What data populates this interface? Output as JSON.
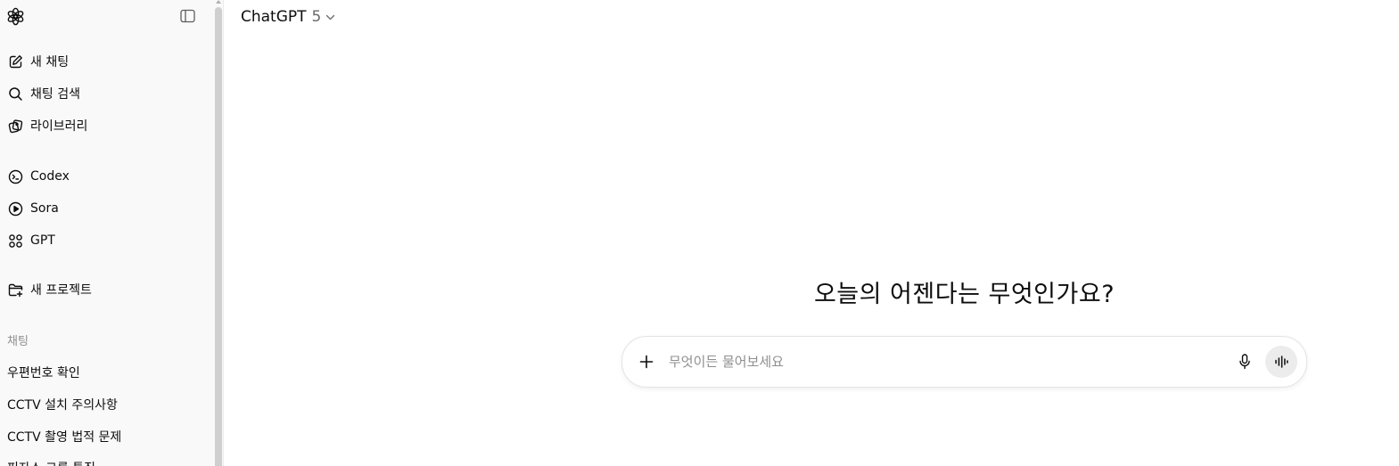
{
  "app": {
    "model_name": "ChatGPT",
    "model_version": "5"
  },
  "sidebar": {
    "primary_items": [
      {
        "label": "새 채팅",
        "icon": "edit-icon"
      },
      {
        "label": "채팅 검색",
        "icon": "search-icon"
      },
      {
        "label": "라이브러리",
        "icon": "library-icon"
      }
    ],
    "tool_items": [
      {
        "label": "Codex",
        "icon": "codex-icon"
      },
      {
        "label": "Sora",
        "icon": "play-circle-icon"
      },
      {
        "label": "GPT",
        "icon": "grid-icon"
      }
    ],
    "project_item": {
      "label": "새 프로젝트",
      "icon": "folder-plus-icon"
    },
    "chats_section_label": "채팅",
    "chats": [
      "우편번호 확인",
      "CCTV 설치 주의사항",
      "CCTV 촬영 법적 문제",
      "피자스 그룹 특징"
    ]
  },
  "main": {
    "headline": "오늘의 어젠다는 무엇인가요?",
    "composer": {
      "placeholder": "무엇이든 물어보세요",
      "value": ""
    }
  },
  "colors": {
    "sidebar_bg": "#f9f9f9",
    "text_primary": "#0d0d0d",
    "text_muted": "#8f8f8f",
    "voice_button_bg": "#ececec"
  }
}
